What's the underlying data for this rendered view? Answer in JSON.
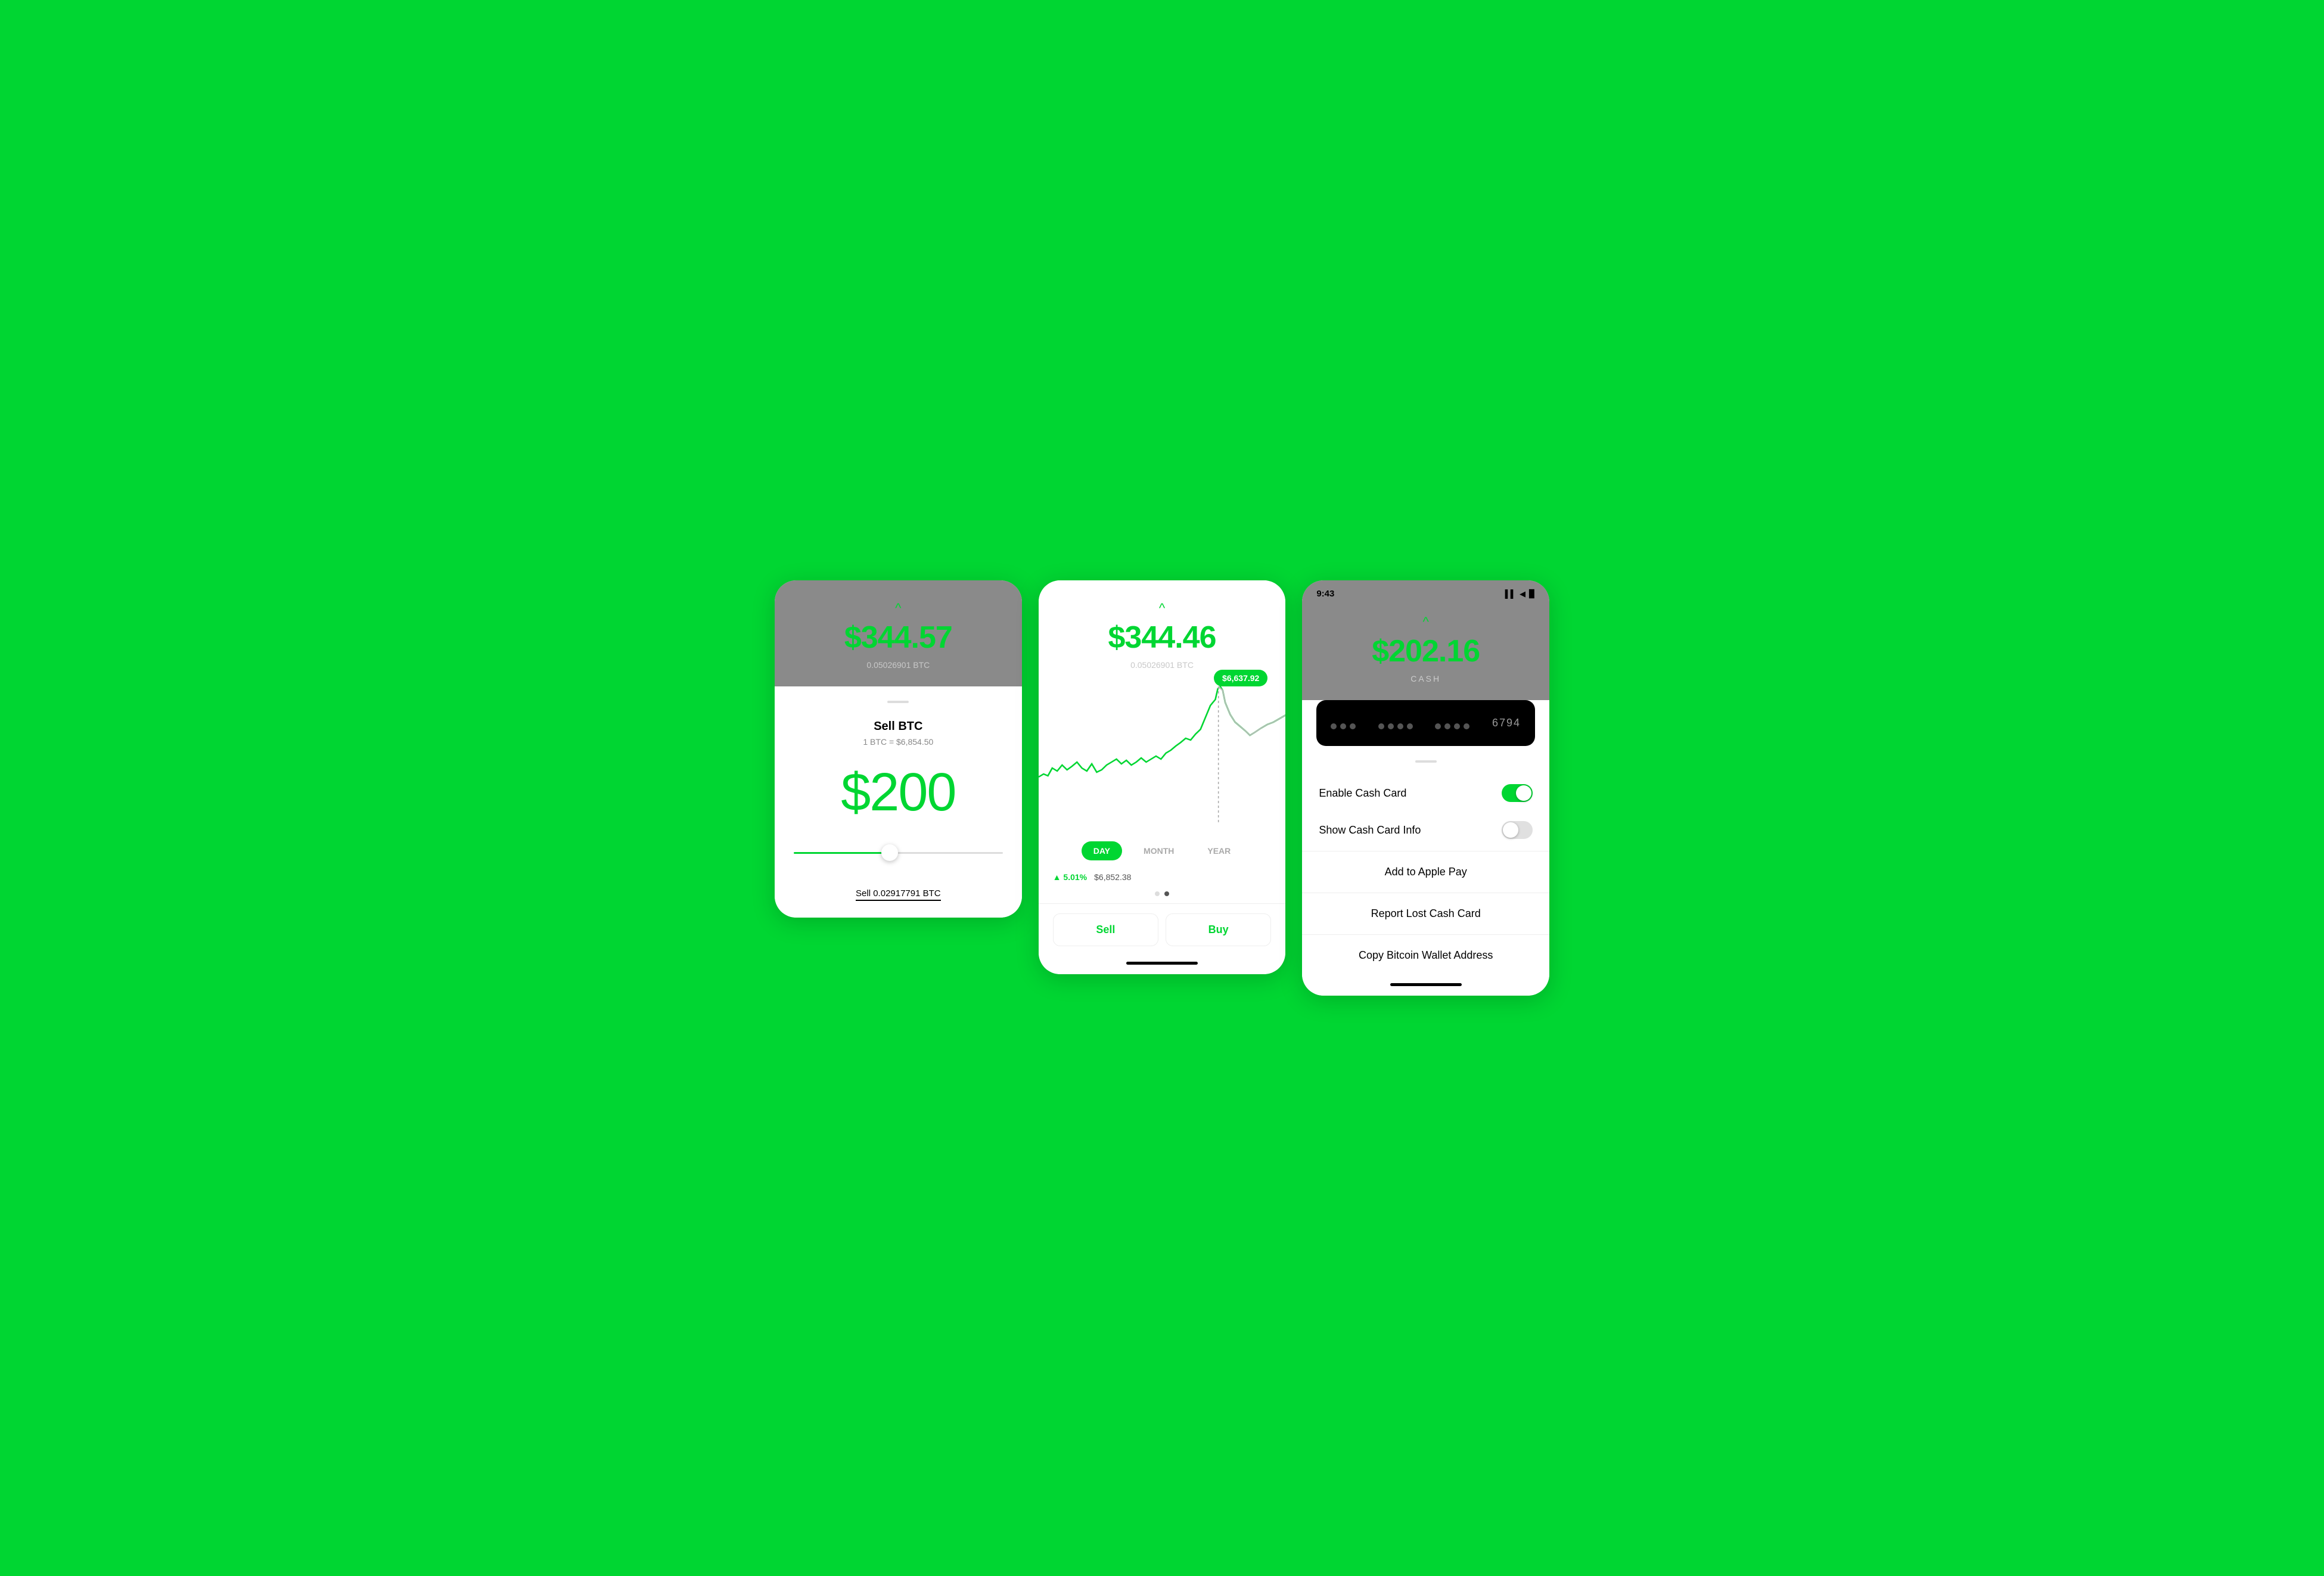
{
  "screen1": {
    "top": {
      "chevron": "^",
      "amount": "$344.57",
      "btc_amount": "0.05026901 BTC"
    },
    "sell": {
      "title": "Sell BTC",
      "rate": "1 BTC = $6,854.50",
      "display_amount": "$200",
      "footer": "Sell 0.02917791 BTC"
    }
  },
  "screen2": {
    "top": {
      "chevron": "^",
      "amount": "$344.46",
      "btc_amount": "0.05026901 BTC"
    },
    "chart": {
      "tooltip_price": "$6,637.92",
      "tooltip_visible": true
    },
    "tabs": [
      {
        "label": "DAY",
        "active": true
      },
      {
        "label": "MONTH",
        "active": false
      },
      {
        "label": "YEAR",
        "active": false
      }
    ],
    "stats": {
      "change_pct": "▲ 5.01%",
      "price": "$6,852.38"
    },
    "actions": {
      "sell_label": "Sell",
      "buy_label": "Buy"
    }
  },
  "screen3": {
    "status_bar": {
      "time": "9:43",
      "signal": "▌▌",
      "wifi": "◀",
      "battery": "▉"
    },
    "top": {
      "chevron": "^",
      "amount": "$202.16",
      "label": "CASH"
    },
    "card": {
      "dots1": "● ● ●",
      "dots2": "● ● ● ●",
      "dots3": "● ● ● ●",
      "last4": "6794"
    },
    "settings": [
      {
        "label": "Enable Cash Card",
        "toggle": true,
        "toggle_on": true
      },
      {
        "label": "Show Cash Card Info",
        "toggle": true,
        "toggle_on": false
      }
    ],
    "menu_items": [
      "Add to Apple Pay",
      "Report Lost Cash Card",
      "Copy Bitcoin Wallet Address"
    ]
  },
  "colors": {
    "green": "#00D632",
    "gray_bg": "#8a8a8a"
  }
}
